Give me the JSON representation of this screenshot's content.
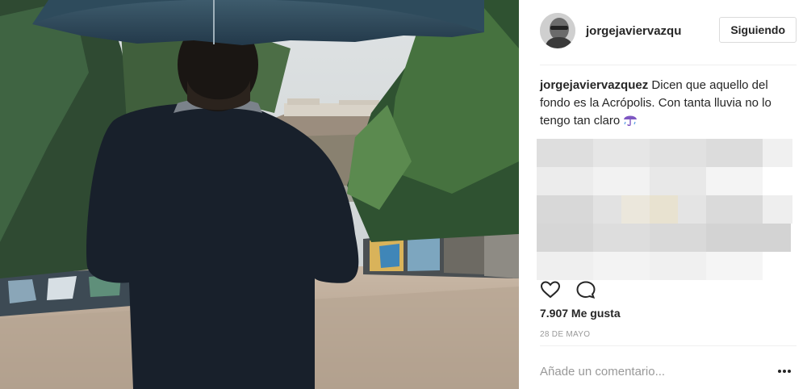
{
  "post": {
    "username": "jorgejavierv azqu",
    "follow_label": "Siguiendo",
    "caption_user": "jorgejavierv azquez",
    "caption_text": " Dicen que aquello del fondo es la Acrópolis. Con tanta lluvia no lo tengo tan claro ",
    "caption_emoji": "umbrella-with-rain-emoji",
    "likes": "7.907 Me gusta",
    "date": "28 de mayo",
    "comment_placeholder": "Añade un comentario..."
  },
  "icons": {
    "like": "heart-icon",
    "comment": "comment-icon",
    "more": "more-options-icon"
  },
  "colors": {
    "text": "#262626",
    "muted": "#999999",
    "border": "#dbdbdb",
    "divider": "#efefef"
  }
}
